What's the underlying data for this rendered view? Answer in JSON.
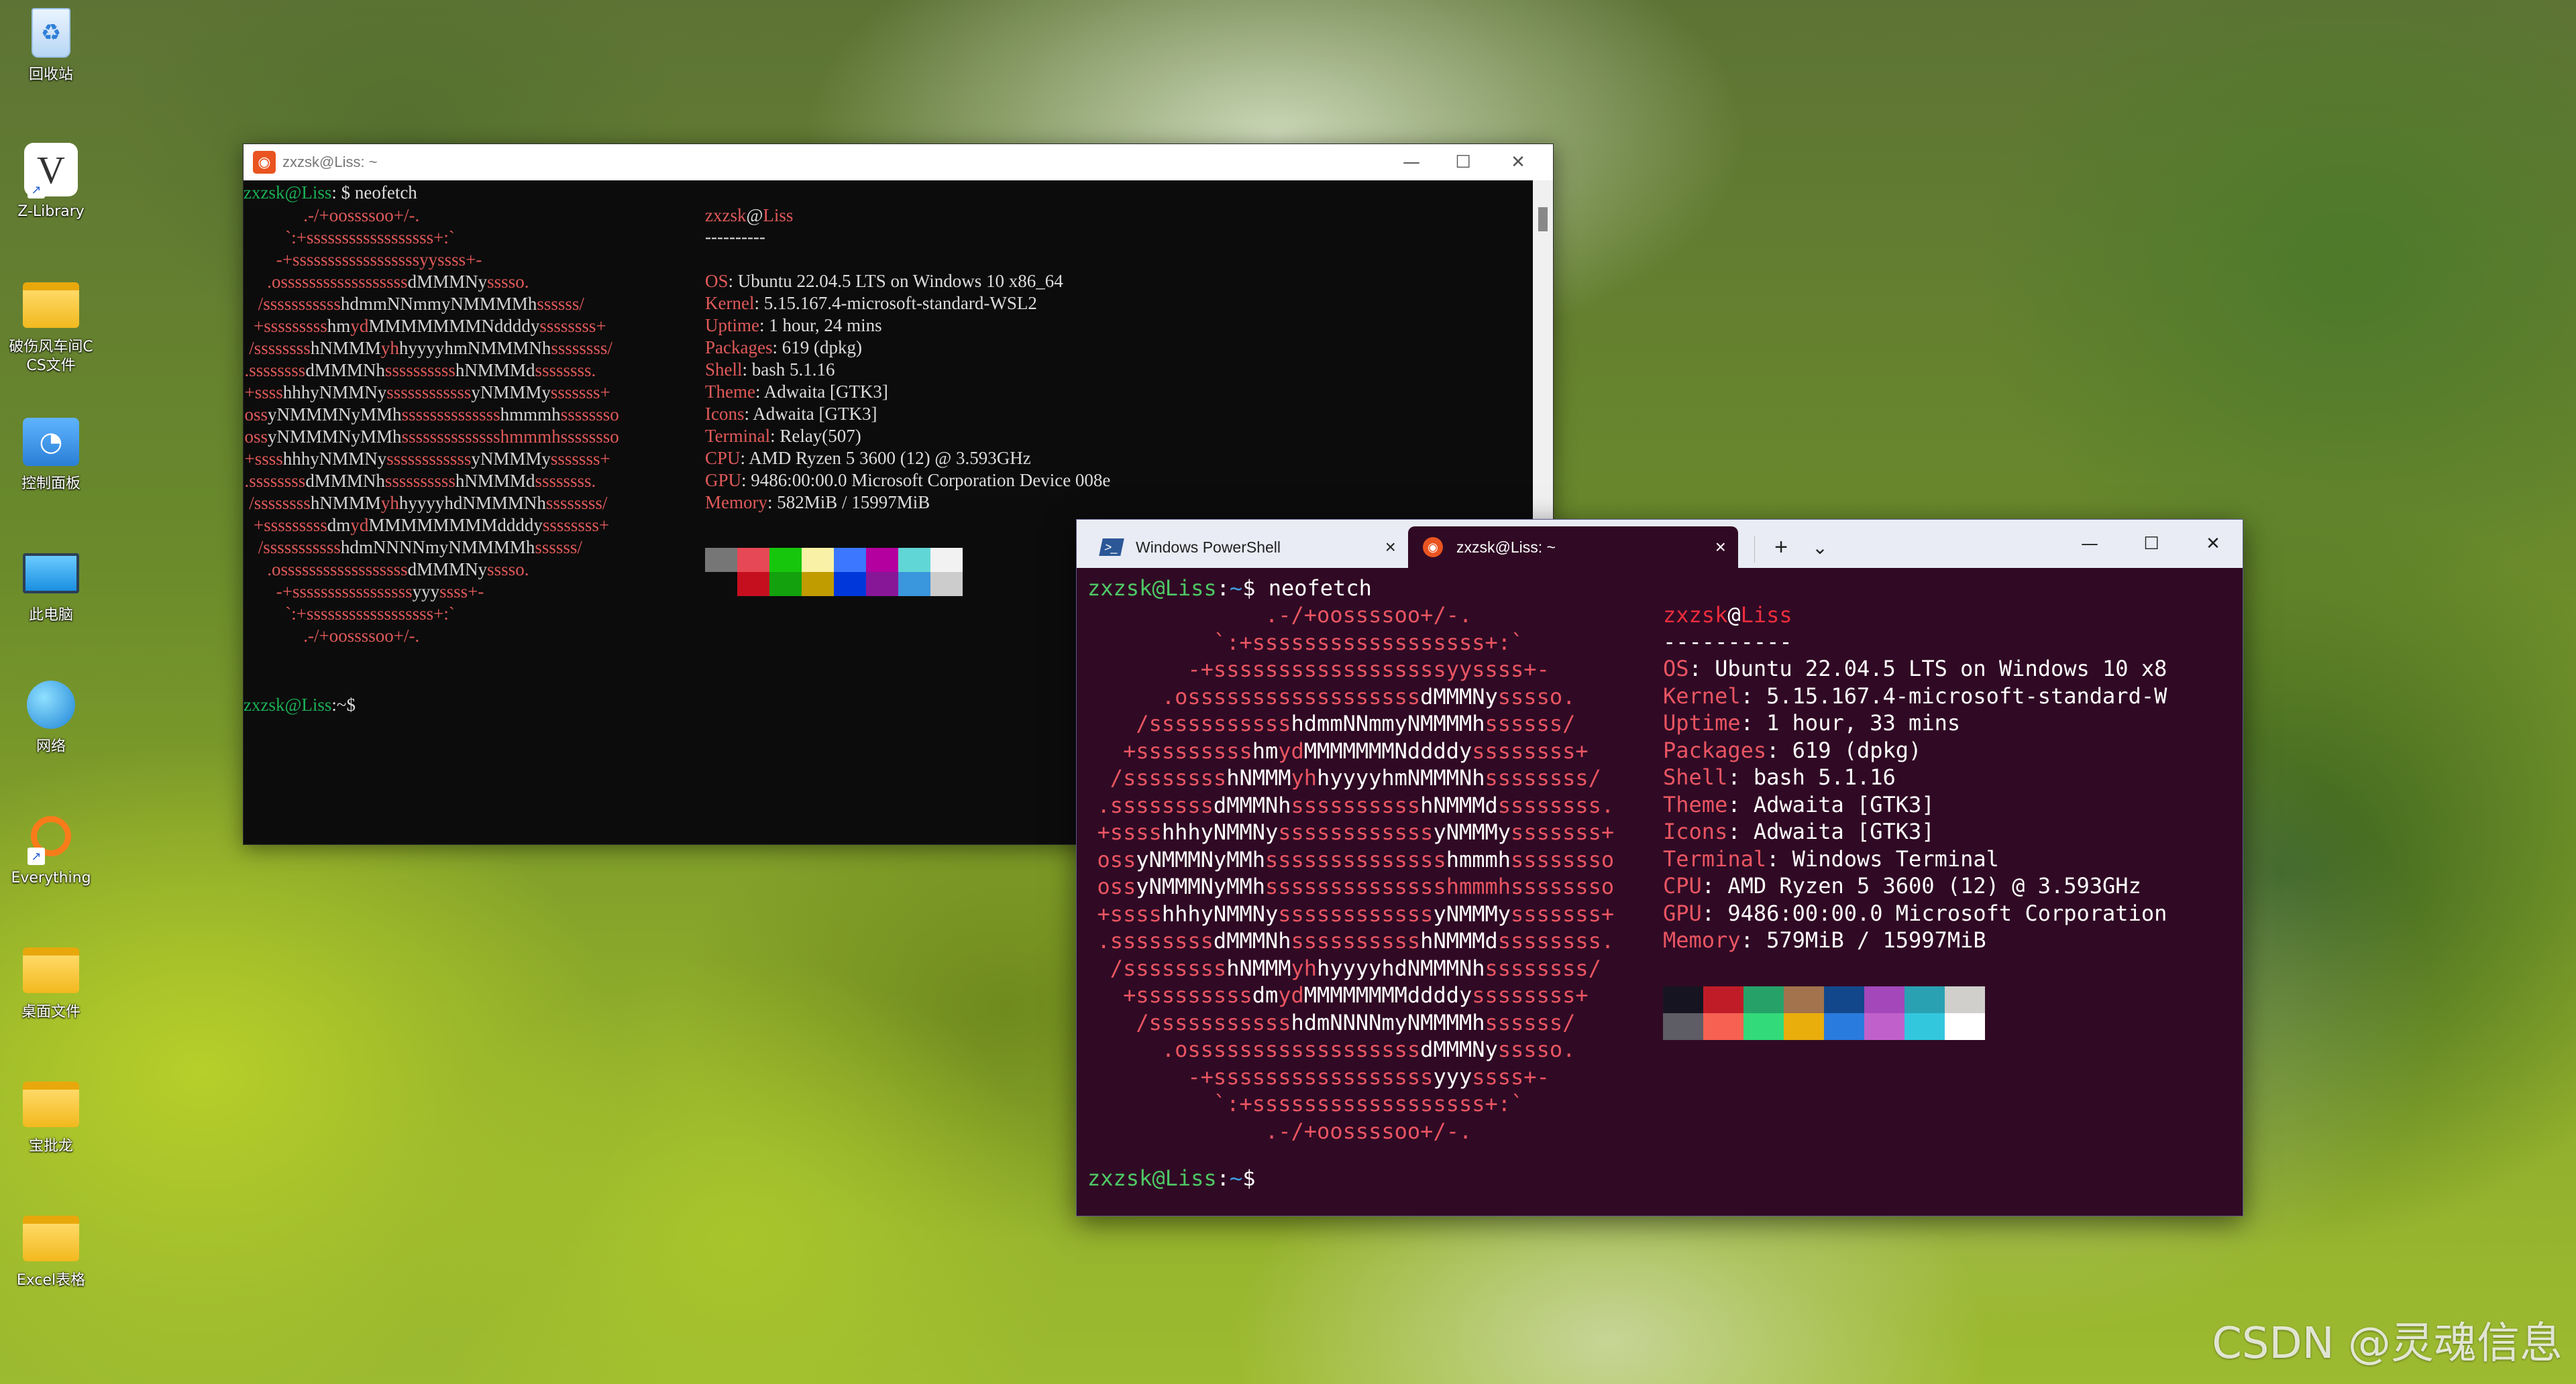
{
  "desktop_icons": [
    {
      "label": "回收站",
      "icon": "recycle-bin-icon",
      "shortcut": false
    },
    {
      "label": "Z-Library",
      "icon": "z-library-icon",
      "shortcut": true
    },
    {
      "label": "破伤风车间CCS文件",
      "icon": "folder-icon",
      "shortcut": false
    },
    {
      "label": "控制面板",
      "icon": "control-panel-icon",
      "shortcut": false
    },
    {
      "label": "此电脑",
      "icon": "computer-icon",
      "shortcut": false
    },
    {
      "label": "网络",
      "icon": "network-icon",
      "shortcut": false
    },
    {
      "label": "Everything",
      "icon": "everything-search-icon",
      "shortcut": true
    },
    {
      "label": "桌面文件",
      "icon": "folder-icon",
      "shortcut": false
    },
    {
      "label": "宝批龙",
      "icon": "folder-icon",
      "shortcut": false
    },
    {
      "label": "Excel表格",
      "icon": "folder-icon",
      "shortcut": false
    }
  ],
  "wsl_window": {
    "title": "zxzsk@Liss: ~",
    "controls": {
      "minimize": "—",
      "maximize": "☐",
      "close": "✕"
    },
    "prompt_user": "zxzsk@Liss",
    "prompt_rest": ": $ neofetch",
    "prompt2_user": "zxzsk@Liss",
    "prompt2_rest": ":~$",
    "header_user": "zxzsk",
    "header_at": "@",
    "header_host": "Liss",
    "separator": "----------",
    "info": [
      {
        "key": "OS",
        "value": ": Ubuntu 22.04.5 LTS on Windows 10 x86_64"
      },
      {
        "key": "Kernel",
        "value": ": 5.15.167.4-microsoft-standard-WSL2"
      },
      {
        "key": "Uptime",
        "value": ": 1 hour, 24 mins"
      },
      {
        "key": "Packages",
        "value": ": 619 (dpkg)"
      },
      {
        "key": "Shell",
        "value": ": bash 5.1.16"
      },
      {
        "key": "Theme",
        "value": ": Adwaita [GTK3]"
      },
      {
        "key": "Icons",
        "value": ": Adwaita [GTK3]"
      },
      {
        "key": "Terminal",
        "value": ": Relay(507)"
      },
      {
        "key": "CPU",
        "value": ": AMD Ryzen 5 3600 (12) @ 3.593GHz"
      },
      {
        "key": "GPU",
        "value": ": 9486:00:00.0 Microsoft Corporation Device 008e"
      },
      {
        "key": "Memory",
        "value": ": 582MiB / 15997MiB"
      }
    ],
    "palette": [
      "#767676",
      "#e74856",
      "#16c60c",
      "#f9f1a5",
      "#3b78ff",
      "#b4009e",
      "#61d6d6",
      "#f2f2f2",
      "#0c0c0c",
      "#c50f1f",
      "#13a10e",
      "#c19c00",
      "#0037da",
      "#881798",
      "#3a96dd",
      "#cccccc"
    ]
  },
  "terminal_window": {
    "tabs": [
      {
        "label": "Windows PowerShell",
        "icon": "powershell-icon"
      },
      {
        "label": "zxzsk@Liss: ~",
        "icon": "ubuntu-icon"
      }
    ],
    "new_tab": "+",
    "dropdown": "⌄",
    "controls": {
      "minimize": "—",
      "maximize": "☐",
      "close": "✕"
    },
    "prompt_user": "zxzsk@Liss",
    "prompt_colon": ":",
    "prompt_tilde": "~",
    "prompt_cmd": "$ neofetch",
    "prompt2_dollar": "$",
    "header_user": "zxzsk",
    "header_at": "@",
    "header_host": "Liss",
    "separator": "----------",
    "info": [
      {
        "key": "OS",
        "value": ": Ubuntu 22.04.5 LTS on Windows 10 x8"
      },
      {
        "key": "Kernel",
        "value": ": 5.15.167.4-microsoft-standard-W"
      },
      {
        "key": "Uptime",
        "value": ": 1 hour, 33 mins"
      },
      {
        "key": "Packages",
        "value": ": 619 (dpkg)"
      },
      {
        "key": "Shell",
        "value": ": bash 5.1.16"
      },
      {
        "key": "Theme",
        "value": ": Adwaita [GTK3]"
      },
      {
        "key": "Icons",
        "value": ": Adwaita [GTK3]"
      },
      {
        "key": "Terminal",
        "value": ": Windows Terminal"
      },
      {
        "key": "CPU",
        "value": ": AMD Ryzen 5 3600 (12) @ 3.593GHz"
      },
      {
        "key": "GPU",
        "value": ": 9486:00:00.0 Microsoft Corporation"
      },
      {
        "key": "Memory",
        "value": ": 579MiB / 15997MiB"
      }
    ],
    "palette": [
      "#171421",
      "#c01c28",
      "#26a269",
      "#a2734c",
      "#12488b",
      "#a347ba",
      "#2aa1b3",
      "#d0cfcc",
      "#5e5c64",
      "#f66151",
      "#33da7a",
      "#e9ad0c",
      "#2a7bde",
      "#c061cb",
      "#33c7de",
      "#ffffff"
    ]
  },
  "ascii_logo": [
    {
      "p": [
        "               .-/+oossssoo+/-."
      ]
    },
    {
      "p": [
        "           `:+ssssssssssssssssss+:`"
      ]
    },
    {
      "p": [
        "         -+ssssssssssssssssssyyssss+-"
      ]
    },
    {
      "p": [
        "       .ossssssssssssssssss",
        "dMMMNy",
        "sssso."
      ]
    },
    {
      "p": [
        "     /sssssssssss",
        "hdmmNNmmyNMMMMh",
        "ssssss/"
      ]
    },
    {
      "p": [
        "    +sssssssss",
        "hm",
        "yd",
        "MMMMMMMNddddy",
        "ssssssss+"
      ]
    },
    {
      "p": [
        "   /ssssssss",
        "hNMMM",
        "yh",
        "hyyyyhmNMMMNh",
        "ssssssss/"
      ]
    },
    {
      "p": [
        "  .ssssssss",
        "dMMMNh",
        "ssssssssss",
        "hNMMMd",
        "ssssssss."
      ]
    },
    {
      "p": [
        "  +ssss",
        "hhhyNMMNy",
        "ssssssssssss",
        "yNMMMy",
        "sssssss+"
      ]
    },
    {
      "p": [
        "  oss",
        "yNMMMNyMMh",
        "ssssssssssssss",
        "hmmmh",
        "ssssssso"
      ]
    },
    {
      "p": [
        "  oss",
        "yNMMMNyMMh",
        "sssssssssssssshmmmhssssssso"
      ]
    },
    {
      "p": [
        "  +ssss",
        "hhhyNMMNy",
        "ssssssssssss",
        "yNMMMy",
        "sssssss+"
      ]
    },
    {
      "p": [
        "  .ssssssss",
        "dMMMNh",
        "ssssssssss",
        "hNMMMd",
        "ssssssss."
      ]
    },
    {
      "p": [
        "   /ssssssss",
        "hNMMM",
        "yh",
        "hyyyyhdNMMMNh",
        "ssssssss/"
      ]
    },
    {
      "p": [
        "    +sssssssss",
        "dm",
        "yd",
        "MMMMMMMMddddy",
        "ssssssss+"
      ]
    },
    {
      "p": [
        "     /sssssssssss",
        "hdmNNNNmyNMMMMh",
        "ssssss/"
      ]
    },
    {
      "p": [
        "       .ossssssssssssssssss",
        "dMMMNy",
        "sssso."
      ]
    },
    {
      "p": [
        "         -+sssssssssssssssss",
        "yyy",
        "ssss+-"
      ]
    },
    {
      "p": [
        "           `:+ssssssssssssssssss+:`"
      ]
    },
    {
      "p": [
        "               .-/+oossssoo+/-."
      ]
    }
  ],
  "watermark": "CSDN @灵魂信息"
}
